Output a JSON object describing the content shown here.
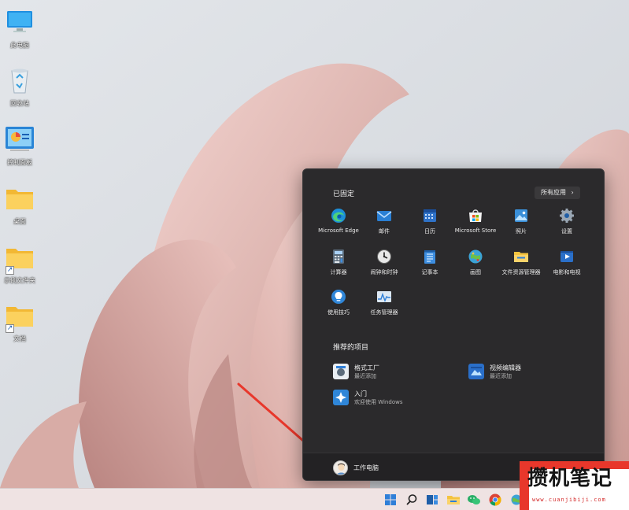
{
  "desktop": {
    "icons": [
      {
        "name": "此电脑",
        "icon": "monitor-icon",
        "shortcut": false
      },
      {
        "name": "回收站",
        "icon": "recycle-bin-icon",
        "shortcut": false
      },
      {
        "name": "控制面板",
        "icon": "control-panel-icon",
        "shortcut": false
      },
      {
        "name": "桌面",
        "icon": "folder-icon",
        "shortcut": false
      },
      {
        "name": "示例文件夹",
        "icon": "folder-icon",
        "shortcut": true
      },
      {
        "name": "文档",
        "icon": "folder-icon",
        "shortcut": true
      }
    ]
  },
  "start_menu": {
    "pinned_title": "已固定",
    "all_apps_label": "所有应用",
    "all_apps_chevron": "›",
    "pinned": [
      {
        "label": "Microsoft Edge",
        "icon": "edge-icon",
        "color": "#1c8fd9"
      },
      {
        "label": "邮件",
        "icon": "mail-icon",
        "color": "#2a7fd4"
      },
      {
        "label": "日历",
        "icon": "calendar-icon",
        "color": "#2f72c8"
      },
      {
        "label": "Microsoft Store",
        "icon": "store-icon",
        "color": "#f4f4f4"
      },
      {
        "label": "照片",
        "icon": "photos-icon",
        "color": "#3a8fd8"
      },
      {
        "label": "设置",
        "icon": "settings-gear-icon",
        "color": "#9aa7b4"
      },
      {
        "label": "计算器",
        "icon": "calculator-icon",
        "color": "#5a6a7a"
      },
      {
        "label": "闹钟和时钟",
        "icon": "clock-icon",
        "color": "#e8e8e8"
      },
      {
        "label": "记事本",
        "icon": "notepad-icon",
        "color": "#3d8ee0"
      },
      {
        "label": "画图",
        "icon": "paint-icon",
        "color": "#3ba3d6"
      },
      {
        "label": "文件资源管理器",
        "icon": "file-explorer-icon",
        "color": "#f6c440"
      },
      {
        "label": "电影和电视",
        "icon": "movies-tv-icon",
        "color": "#2a6fc9"
      },
      {
        "label": "使用技巧",
        "icon": "tips-lightbulb-icon",
        "color": "#2f86d8"
      },
      {
        "label": "任务管理器",
        "icon": "task-manager-icon",
        "color": "#dbe7f3"
      }
    ],
    "recommended_title": "推荐的项目",
    "recommended": [
      {
        "title": "格式工厂",
        "subtitle": "最近添加",
        "icon": "format-factory-icon"
      },
      {
        "title": "视频编辑器",
        "subtitle": "最近添加",
        "icon": "video-editor-icon"
      },
      {
        "title": "入门",
        "subtitle": "欢迎使用 Windows",
        "icon": "get-started-icon"
      }
    ],
    "user_name": "工作电脑"
  },
  "taskbar": {
    "items": [
      "start-button",
      "search-icon",
      "task-view-icon",
      "file-explorer-icon",
      "wechat-icon",
      "chrome-icon",
      "network-icon"
    ]
  },
  "watermark": {
    "text": "攒机笔记",
    "url": "www.cuanjibiji.com"
  },
  "colors": {
    "start_bg": "#2b2a2c",
    "taskbar_bg": "#efe3e3",
    "arrow": "#e8372b"
  }
}
